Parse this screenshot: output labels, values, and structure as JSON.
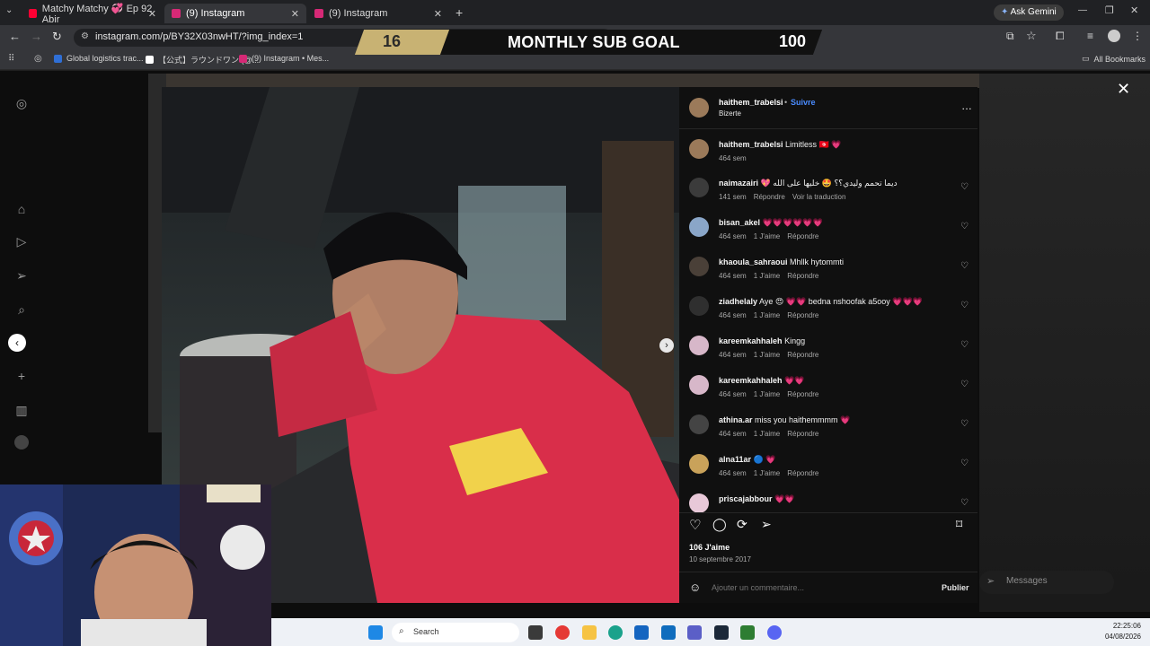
{
  "browser": {
    "tabs": [
      {
        "label": "Matchy Matchy 💞 Ep 92 Abir",
        "icon_color": "#ff0033"
      },
      {
        "label": "(9) Instagram",
        "icon_color": "#d62976"
      },
      {
        "label": "(9) Instagram",
        "icon_color": "#d62976"
      }
    ],
    "ask_gemini": "Ask Gemini",
    "url": "instagram.com/p/BY32X03nwHT/?img_index=1",
    "bookmarks": [
      {
        "label": "Global logistics trac...",
        "icon_color": "#2f6fd6"
      },
      {
        "label": "【公式】ラウンドワン (@...",
        "icon_color": "#ffffff"
      },
      {
        "label": "(9) Instagram • Mes...",
        "icon_color": "#d62976"
      }
    ],
    "all_bookmarks": "All Bookmarks"
  },
  "sub_goal": {
    "current": "16",
    "title": "MONTHLY SUB GOAL",
    "target": "100"
  },
  "post": {
    "author": "haithem_trabelsi",
    "follow": "Suivre",
    "location": "Bizerte",
    "caption_user": "haithem_trabelsi",
    "caption_text": "Limitless 🇹🇳 💗",
    "caption_time": "464 sem",
    "likes": "106 J'aime",
    "date": "10 septembre 2017",
    "comment_placeholder": "Ajouter un commentaire...",
    "publish": "Publier"
  },
  "comments": [
    {
      "user": "naimazairi",
      "text": "💖 ديما تحمم وليدي؟؟ 🤩 خليها على الله",
      "time": "141 sem",
      "likes": "",
      "reply": "Répondre",
      "extra": "Voir la traduction",
      "avatar": "#3b3b3b"
    },
    {
      "user": "bisan_akel",
      "text": "💗💗💗💗💗💗",
      "time": "464 sem",
      "likes": "1 J'aime",
      "reply": "Répondre",
      "extra": "",
      "avatar": "#8aa6c8"
    },
    {
      "user": "khaoula_sahraoui",
      "text": "Mhllk hytommti",
      "time": "464 sem",
      "likes": "1 J'aime",
      "reply": "Répondre",
      "extra": "",
      "avatar": "#4a4038"
    },
    {
      "user": "ziadhelaly",
      "text": "Aye 😍 💗💗 bedna nshoofak a5ooy 💗💗💗",
      "time": "464 sem",
      "likes": "1 J'aime",
      "reply": "Répondre",
      "extra": "",
      "avatar": "#2f2f2f"
    },
    {
      "user": "kareemkahhaleh",
      "text": "Kingg",
      "time": "464 sem",
      "likes": "1 J'aime",
      "reply": "Répondre",
      "extra": "",
      "avatar": "#d7b7c9"
    },
    {
      "user": "kareemkahhaleh",
      "text": "💗💗",
      "time": "464 sem",
      "likes": "1 J'aime",
      "reply": "Répondre",
      "extra": "",
      "avatar": "#d7b7c9"
    },
    {
      "user": "athina.ar",
      "text": "miss you haithemmmm 💗",
      "time": "464 sem",
      "likes": "1 J'aime",
      "reply": "Répondre",
      "extra": "",
      "avatar": "#444444"
    },
    {
      "user": "alna11ar",
      "text": "🔵 💗",
      "time": "464 sem",
      "likes": "1 J'aime",
      "reply": "Répondre",
      "extra": "",
      "avatar": "#c9a25a"
    },
    {
      "user": "priscajabbour",
      "text": "💗💗",
      "time": "",
      "likes": "",
      "reply": "",
      "extra": "",
      "avatar": "#e8c8d8"
    }
  ],
  "messages_label": "Messages",
  "taskbar": {
    "search": "Search",
    "time": "22:25:06",
    "date": "04/08/2026"
  }
}
